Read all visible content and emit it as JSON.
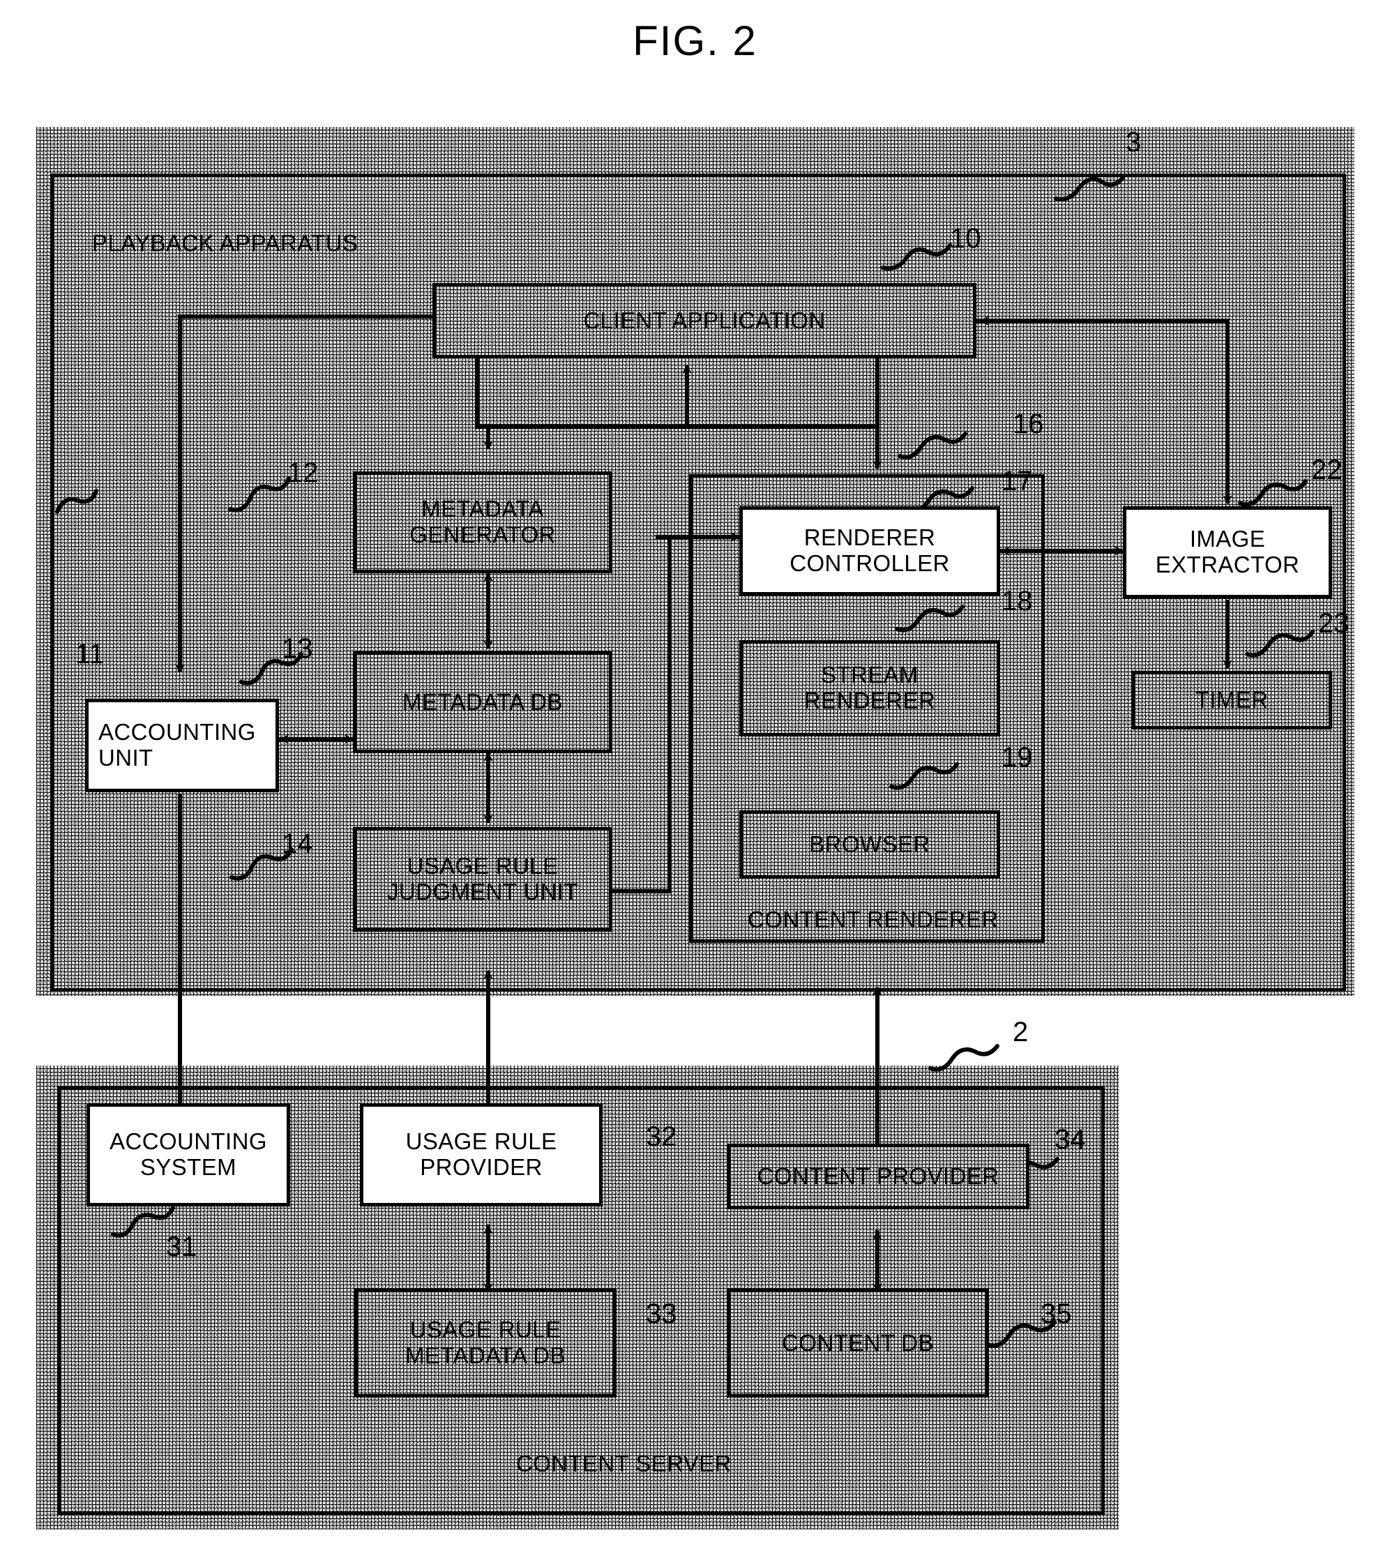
{
  "figure": {
    "title": "FIG. 2"
  },
  "diagram": {
    "type": "block-diagram",
    "sections": [
      {
        "id": "playback",
        "label": "PLAYBACK APPARATUS",
        "ref": "3"
      },
      {
        "id": "server",
        "label": "CONTENT SERVER",
        "ref": "2"
      }
    ],
    "blocks": [
      {
        "id": "client_application",
        "label": "CLIENT APPLICATION",
        "ref": "10",
        "fill": "texture"
      },
      {
        "id": "metadata_generator",
        "label": "METADATA\nGENERATOR",
        "ref": "12",
        "fill": "texture"
      },
      {
        "id": "accounting_unit",
        "label": "ACCOUNTING\nUNIT",
        "ref": "11",
        "fill": "white"
      },
      {
        "id": "metadata_db",
        "label": "METADATA DB",
        "ref": "13",
        "fill": "texture"
      },
      {
        "id": "usage_rule_judgment",
        "label": "USAGE RULE\nJUDGMENT UNIT",
        "ref": "14",
        "fill": "texture"
      },
      {
        "id": "content_renderer",
        "label": "CONTENT RENDERER",
        "ref": "16",
        "fill": "texture"
      },
      {
        "id": "renderer_controller",
        "label": "RENDERER\nCONTROLLER",
        "ref": "17",
        "fill": "white"
      },
      {
        "id": "stream_renderer",
        "label": "STREAM\nRENDERER",
        "ref": "18",
        "fill": "texture"
      },
      {
        "id": "browser",
        "label": "BROWSER",
        "ref": "19",
        "fill": "texture"
      },
      {
        "id": "image_extractor",
        "label": "IMAGE\nEXTRACTOR",
        "ref": "22",
        "fill": "white"
      },
      {
        "id": "timer",
        "label": "TIMER",
        "ref": "23",
        "fill": "texture"
      },
      {
        "id": "accounting_system",
        "label": "ACCOUNTING\nSYSTEM",
        "ref": "31",
        "fill": "white"
      },
      {
        "id": "usage_rule_provider",
        "label": "USAGE RULE\nPROVIDER",
        "ref": "32",
        "fill": "white"
      },
      {
        "id": "usage_rule_metadata_db",
        "label": "USAGE RULE\nMETADATA DB",
        "ref": "33",
        "fill": "texture"
      },
      {
        "id": "content_provider",
        "label": "CONTENT PROVIDER",
        "ref": "34",
        "fill": "texture"
      },
      {
        "id": "content_db",
        "label": "CONTENT DB",
        "ref": "35",
        "fill": "texture"
      }
    ],
    "labels": {
      "client_application": "CLIENT APPLICATION",
      "metadata_generator": "METADATA\nGENERATOR",
      "accounting_unit": "ACCOUNTING\nUNIT",
      "metadata_db": "METADATA DB",
      "usage_rule_judgment": "USAGE RULE\nJUDGMENT UNIT",
      "content_renderer": "CONTENT RENDERER",
      "renderer_controller": "RENDERER\nCONTROLLER",
      "stream_renderer": "STREAM\nRENDERER",
      "browser": "BROWSER",
      "image_extractor": "IMAGE\nEXTRACTOR",
      "timer": "TIMER",
      "playback_apparatus": "PLAYBACK APPARATUS",
      "content_server": "CONTENT SERVER",
      "accounting_system": "ACCOUNTING\nSYSTEM",
      "usage_rule_provider": "USAGE RULE\nPROVIDER",
      "usage_rule_metadata_db": "USAGE RULE\nMETADATA DB",
      "content_provider": "CONTENT PROVIDER",
      "content_db": "CONTENT DB"
    },
    "refs": {
      "playback_apparatus": "3",
      "content_server": "2",
      "client_application": "10",
      "accounting_unit": "11",
      "metadata_generator": "12",
      "metadata_db": "13",
      "usage_rule_judgment": "14",
      "content_renderer": "16",
      "renderer_controller": "17",
      "stream_renderer": "18",
      "browser": "19",
      "image_extractor": "22",
      "timer": "23",
      "accounting_system": "31",
      "usage_rule_provider": "32",
      "usage_rule_metadata_db": "33",
      "content_provider": "34",
      "content_db": "35"
    },
    "colors": {
      "ink": "#000000",
      "paper": "#ffffff"
    }
  }
}
